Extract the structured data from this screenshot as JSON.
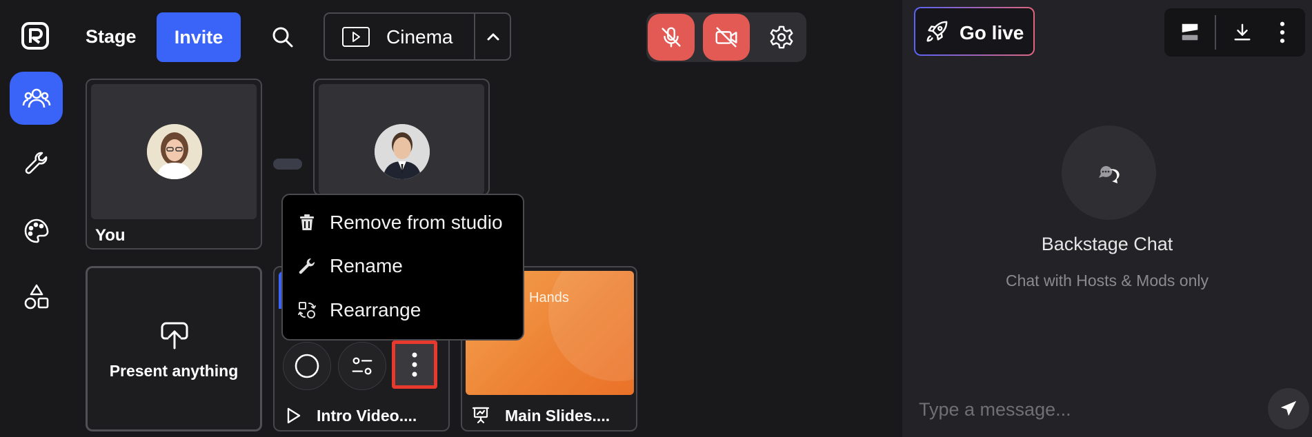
{
  "header": {
    "stage_label": "Stage",
    "invite_label": "Invite",
    "layout_label": "Cinema"
  },
  "participants": [
    {
      "name": "You"
    },
    {
      "name": ""
    }
  ],
  "context_menu": {
    "items": [
      {
        "label": "Remove from studio",
        "icon": "trash-icon"
      },
      {
        "label": "Rename",
        "icon": "wrench-icon"
      },
      {
        "label": "Rearrange",
        "icon": "rearrange-icon"
      }
    ]
  },
  "media": {
    "present_label": "Present anything",
    "video_title": "Intro Video....",
    "slides_title": "Main Slides....",
    "slides_thumb_text": "Hands"
  },
  "right_panel": {
    "go_live_label": "Go live",
    "chat_title": "Backstage Chat",
    "chat_subtitle": "Chat with Hosts & Mods only",
    "message_placeholder": "Type a message..."
  },
  "colors": {
    "accent": "#3a64f8",
    "danger": "#e35a55",
    "highlight": "#e8392f",
    "background": "#19191b",
    "panel": "#222227"
  }
}
